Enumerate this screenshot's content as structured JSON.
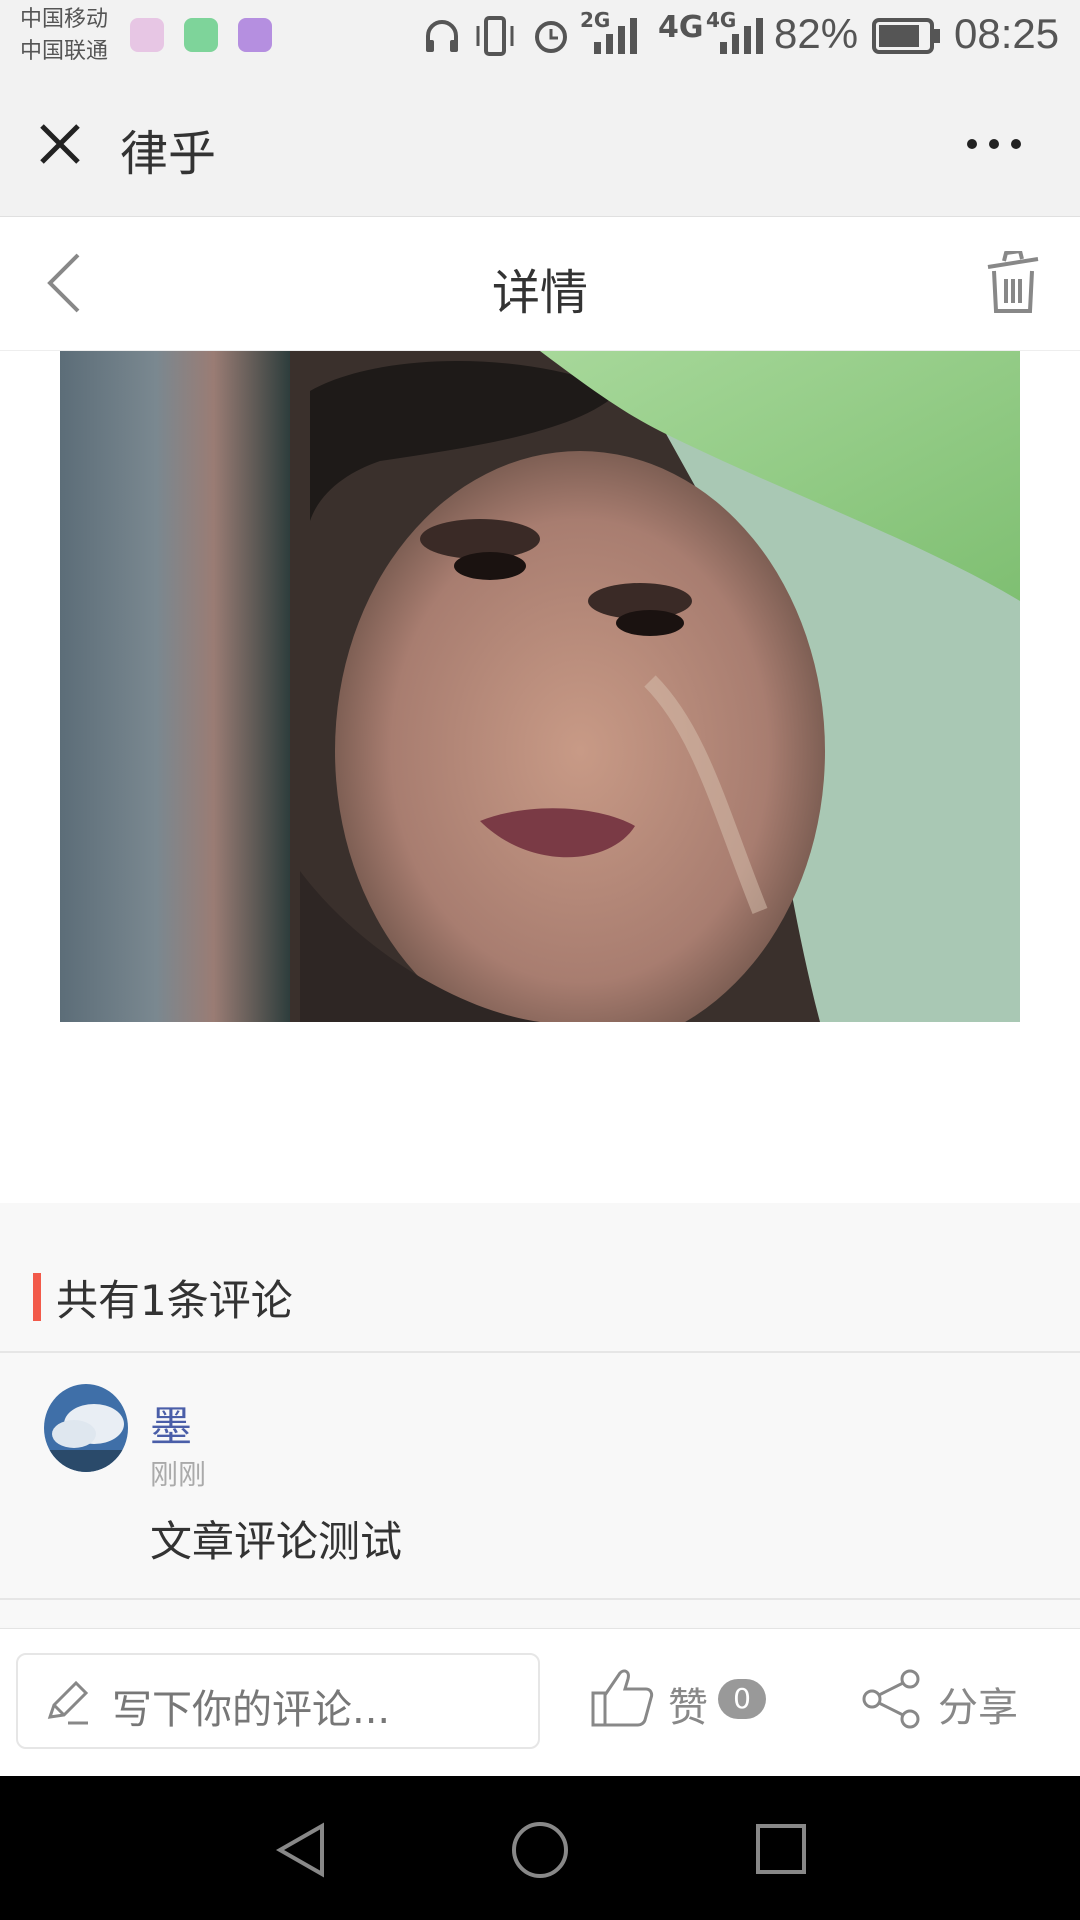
{
  "status_bar": {
    "carrier_1": "中国移动",
    "carrier_2": "中国联通",
    "net_2g": "2G",
    "net_4g_a": "4G",
    "net_4g_b": "4G",
    "battery_percent": "82%",
    "time": "08:25"
  },
  "wechat_bar": {
    "title": "律乎"
  },
  "nav": {
    "title": "详情"
  },
  "comments": {
    "count_label": "共有1条评论",
    "items": [
      {
        "user": "墨",
        "time": "刚刚",
        "text": "文章评论测试"
      }
    ]
  },
  "action_bar": {
    "comment_placeholder": "写下你的评论...",
    "like_label": "赞",
    "like_count": "0",
    "share_label": "分享"
  },
  "colors": {
    "accent_red": "#f25a4a",
    "username_blue": "#4a5ea8"
  },
  "icons": [
    "close-icon",
    "more-icon",
    "back-icon",
    "trash-icon",
    "pencil-icon",
    "thumbs-up-icon",
    "share-icon",
    "nav-back-icon",
    "nav-home-icon",
    "nav-recents-icon"
  ]
}
